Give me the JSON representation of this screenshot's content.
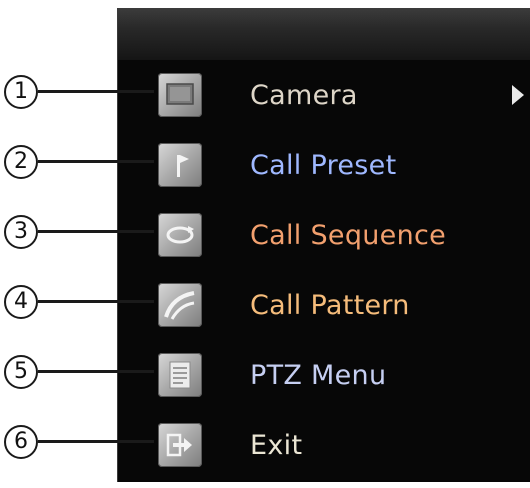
{
  "menu": {
    "items": [
      {
        "number": "1",
        "label": "Camera",
        "icon": "camera-icon",
        "color": "#ded6c8",
        "has_submenu": true
      },
      {
        "number": "2",
        "label": "Call Preset",
        "icon": "flag-icon",
        "color": "#9fb8ff",
        "has_submenu": false
      },
      {
        "number": "3",
        "label": "Call Sequence",
        "icon": "sequence-icon",
        "color": "#f2a06e",
        "has_submenu": false
      },
      {
        "number": "4",
        "label": "Call Pattern",
        "icon": "pattern-icon",
        "color": "#f5bc7b",
        "has_submenu": false
      },
      {
        "number": "5",
        "label": "PTZ Menu",
        "icon": "menu-list-icon",
        "color": "#c6cff2",
        "has_submenu": false
      },
      {
        "number": "6",
        "label": "Exit",
        "icon": "exit-icon",
        "color": "#ebe6d4",
        "has_submenu": false
      }
    ]
  },
  "callouts": [
    "①",
    "②",
    "③",
    "④",
    "⑤",
    "⑥"
  ]
}
